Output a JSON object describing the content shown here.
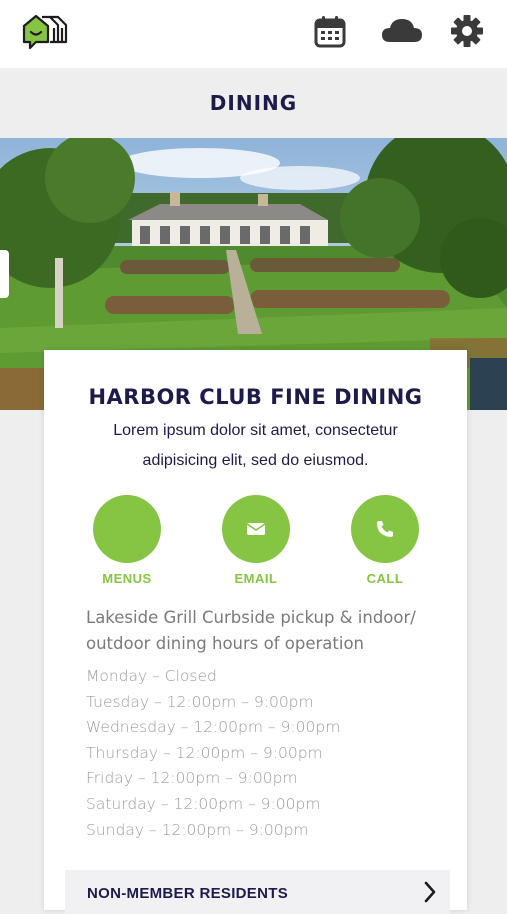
{
  "header": {
    "logo_icon": "app-logo-icon",
    "icons": [
      "calendar-icon",
      "cloud-icon",
      "gear-icon"
    ]
  },
  "page": {
    "title": "DINING"
  },
  "venue": {
    "name": "HARBOR CLUB FINE DINING",
    "description": "Lorem ipsum dolor sit amet, consectetur adipisicing elit, sed do eiusmod."
  },
  "actions": [
    {
      "label": "MENUS",
      "icon": "none"
    },
    {
      "label": "EMAIL",
      "icon": "envelope-icon"
    },
    {
      "label": "CALL",
      "icon": "phone-icon"
    }
  ],
  "hours": {
    "heading": "Lakeside Grill Curbside pickup & indoor/ outdoor dining hours of operation",
    "days": [
      "Monday – Closed",
      "Tuesday – 12:00pm – 9:00pm",
      "Wednesday – 12:00pm – 9:00pm",
      "Thursday – 12:00pm – 9:00pm",
      "Friday – 12:00pm – 9:00pm",
      "Saturday – 12:00pm – 9:00pm",
      "Sunday – 12:00pm – 9:00pm"
    ]
  },
  "sections": [
    {
      "label": "NON-MEMBER RESIDENTS"
    }
  ],
  "colors": {
    "accent": "#86c443",
    "navy": "#1c1b4a",
    "background": "#efeeef"
  }
}
